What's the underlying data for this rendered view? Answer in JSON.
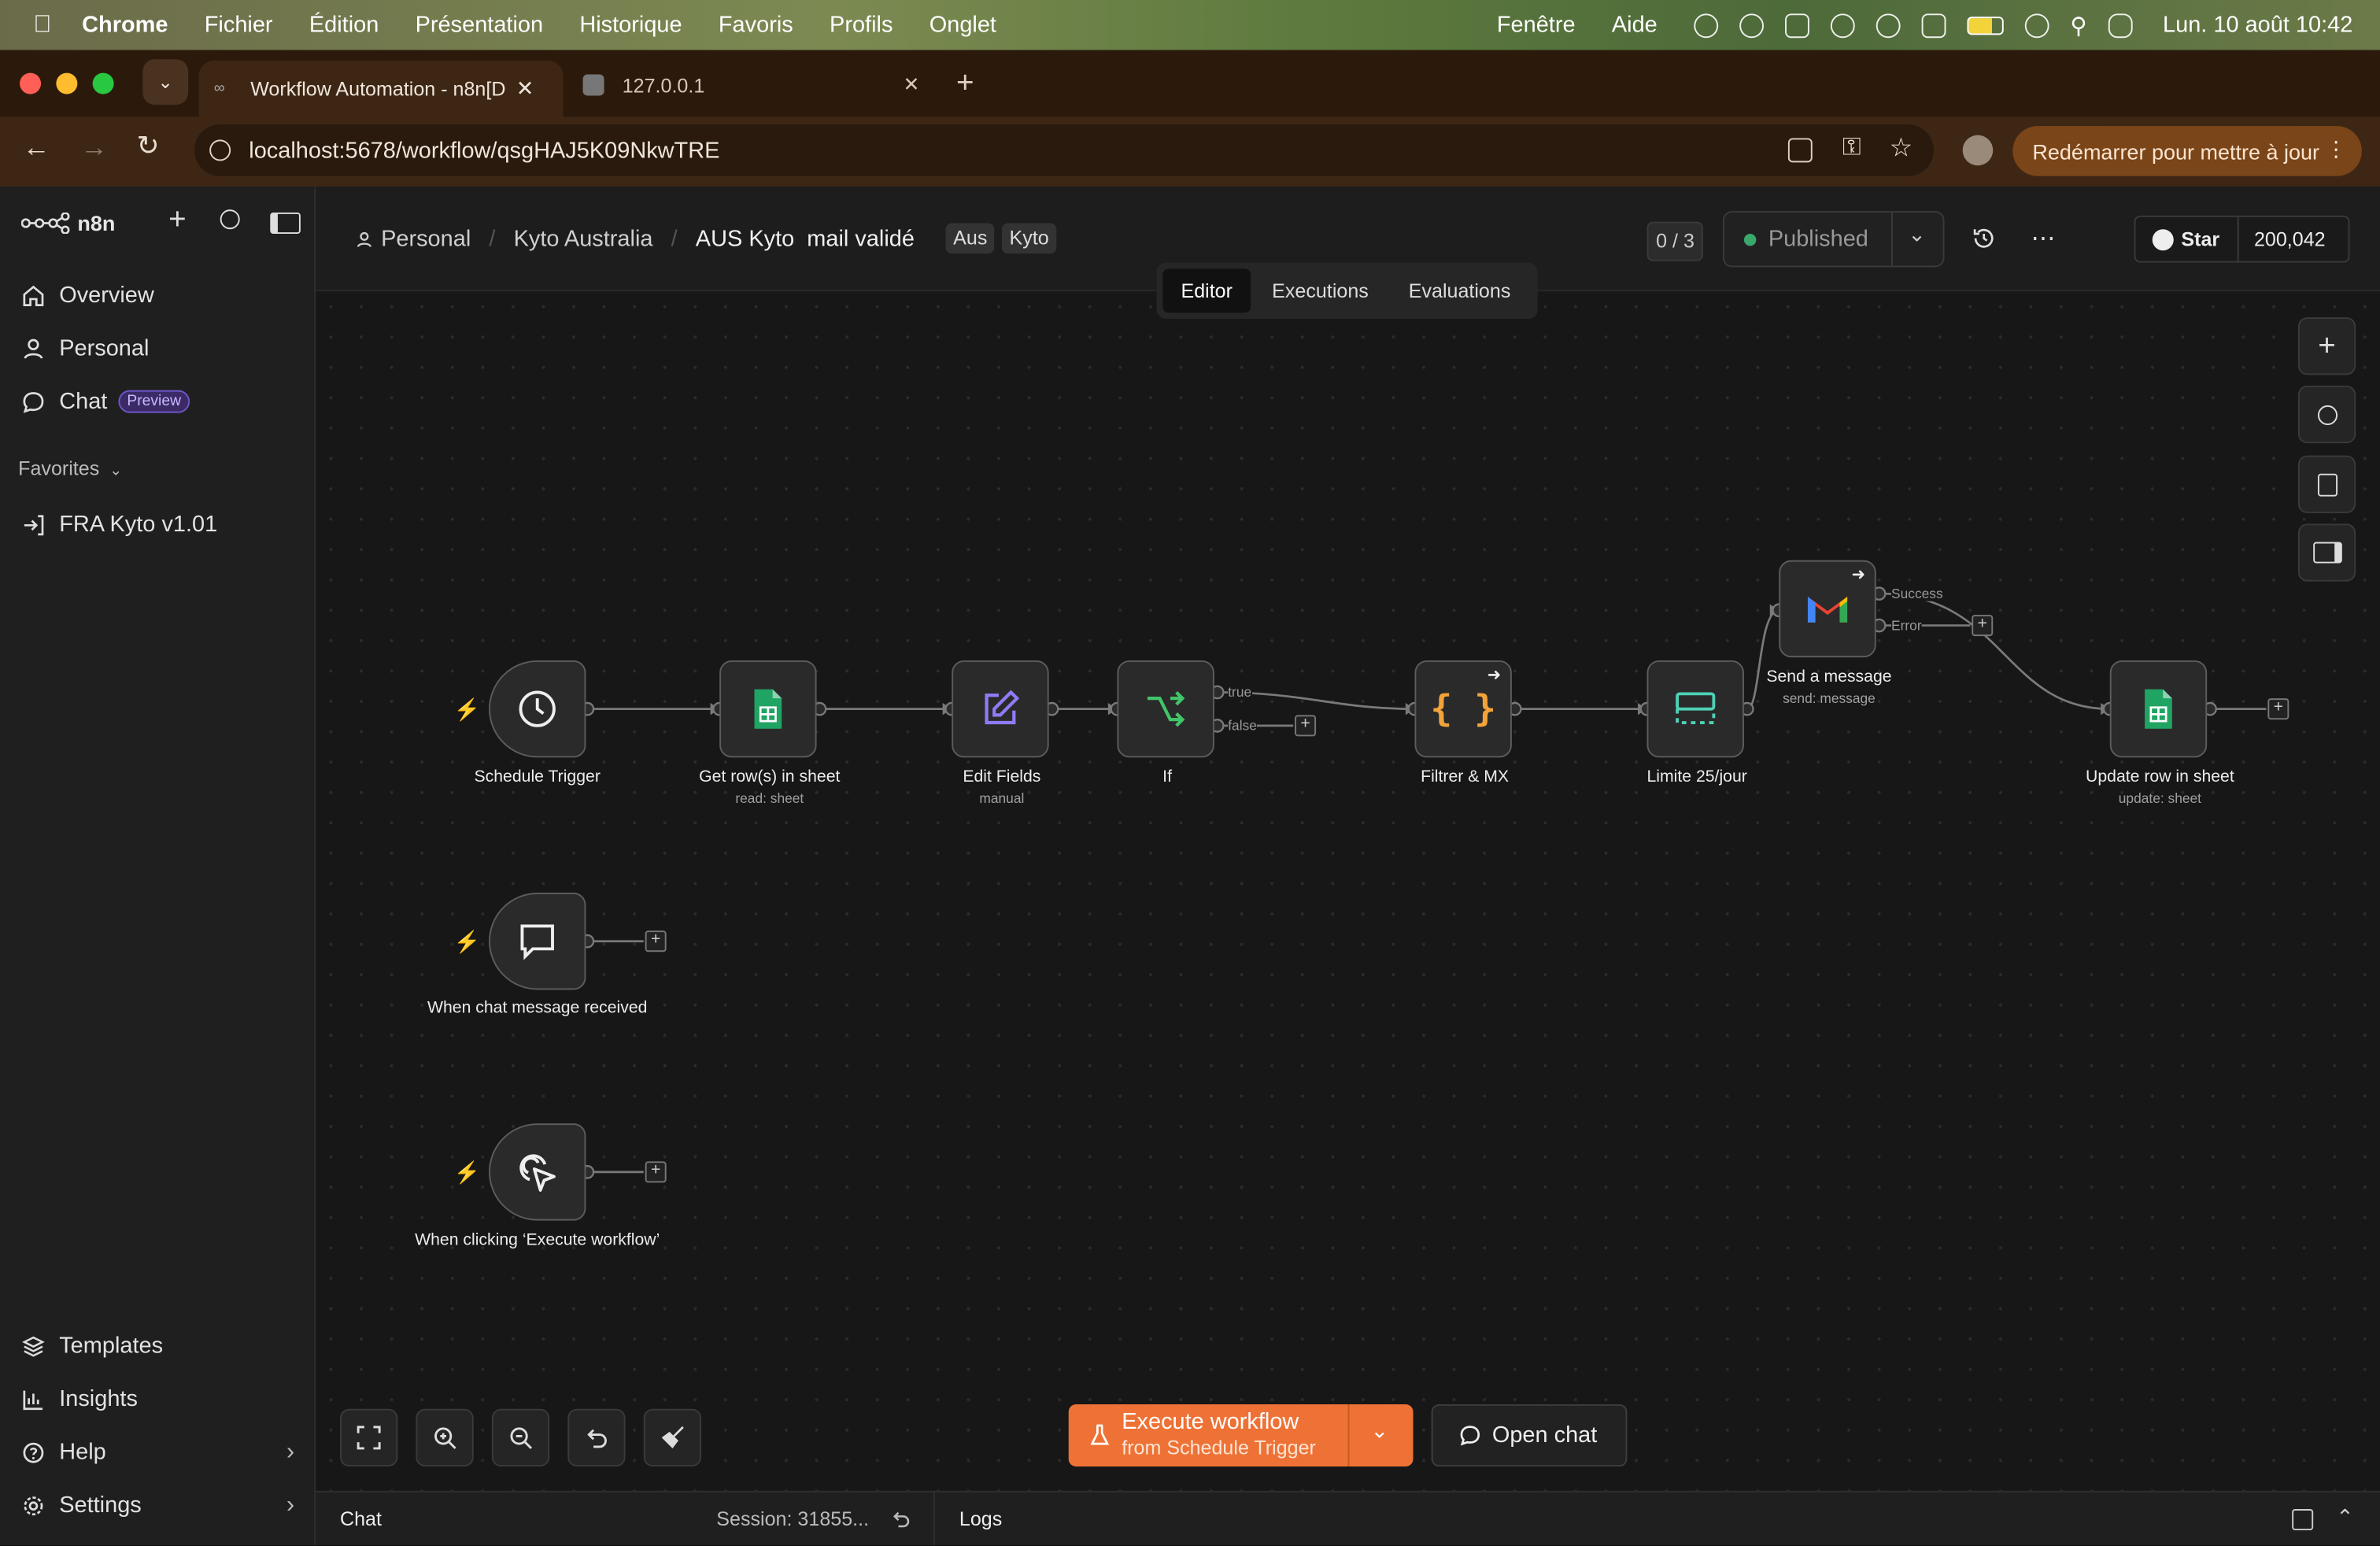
{
  "menubar": {
    "app": "Chrome",
    "items": [
      "Fichier",
      "Édition",
      "Présentation",
      "Historique",
      "Favoris",
      "Profils",
      "Onglet"
    ],
    "right_items": [
      "Fenêtre",
      "Aide"
    ],
    "clock": "Lun. 10 août 10:42"
  },
  "browser": {
    "tabs": [
      {
        "title": "Workflow Automation - n8n[D"
      },
      {
        "title": "127.0.0.1"
      }
    ],
    "url": "localhost:5678/workflow/qsgHAJ5K09NkwTRE",
    "update_button": "Redémarrer pour mettre à jour"
  },
  "sidebar": {
    "brand": "n8n",
    "items": [
      {
        "label": "Overview",
        "icon": "home-icon"
      },
      {
        "label": "Personal",
        "icon": "user-icon"
      },
      {
        "label": "Chat",
        "icon": "chat-icon",
        "badge": "Preview"
      }
    ],
    "favorites_label": "Favorites",
    "favorites": [
      {
        "label": "FRA Kyto v1.01"
      }
    ],
    "bottom_items": [
      {
        "label": "Templates"
      },
      {
        "label": "Insights"
      },
      {
        "label": "Help"
      },
      {
        "label": "Settings"
      }
    ]
  },
  "header": {
    "breadcrumb": [
      "Personal",
      "Kyto Australia",
      "AUS Kyto  mail validé"
    ],
    "tags": [
      "Aus",
      "Kyto"
    ],
    "counter": "0 / 3",
    "publish_label": "Published",
    "star_label": "Star",
    "star_count": "200,042",
    "tabs": [
      {
        "label": "Editor",
        "active": true
      },
      {
        "label": "Executions"
      },
      {
        "label": "Evaluations"
      }
    ]
  },
  "nodes": [
    {
      "label": "Schedule Trigger",
      "sub": ""
    },
    {
      "label": "Get row(s) in sheet",
      "sub": "read: sheet"
    },
    {
      "label": "Edit Fields",
      "sub": "manual"
    },
    {
      "label": "If",
      "sub": ""
    },
    {
      "label": "Filtrer & MX",
      "sub": ""
    },
    {
      "label": "Limite 25/jour",
      "sub": ""
    },
    {
      "label": "Send a message",
      "sub": "send: message"
    },
    {
      "label": "Update row in sheet",
      "sub": "update: sheet"
    },
    {
      "label": "When chat message received",
      "sub": ""
    },
    {
      "label": "When clicking ‘Execute workflow’",
      "sub": ""
    }
  ],
  "branches": {
    "true": "true",
    "false": "false",
    "success": "Success",
    "error": "Error"
  },
  "execute": {
    "label": "Execute workflow",
    "sub": "from Schedule Trigger",
    "open_chat": "Open chat"
  },
  "bottombar": {
    "chat": "Chat",
    "session": "Session: 31855...",
    "logs": "Logs"
  },
  "colors": {
    "accent": "#ee7236",
    "sheets_green": "#1fa463",
    "edit_purple": "#8d7cf6",
    "if_green": "#41c46a",
    "code_orange": "#f2a33a",
    "limit_teal": "#4fd1b5",
    "published_dot": "#3aa76d"
  }
}
